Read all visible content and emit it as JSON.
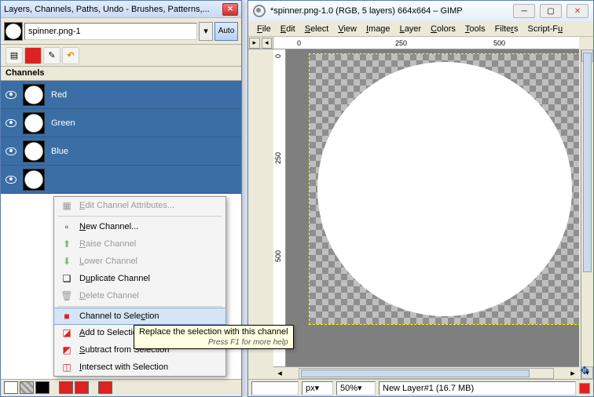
{
  "dock": {
    "title": "Layers, Channels, Paths, Undo - Brushes, Patterns,...",
    "image_selector": {
      "name": "spinner.png-1",
      "auto_label": "Auto"
    },
    "channels_header": "Channels",
    "channels": [
      {
        "name": "Red"
      },
      {
        "name": "Green"
      },
      {
        "name": "Blue"
      },
      {
        "name": ""
      }
    ]
  },
  "context_menu": {
    "items": [
      {
        "label": "Edit Channel Attributes...",
        "enabled": false,
        "icon": "edit"
      },
      {
        "label": "New Channel...",
        "enabled": true,
        "icon": "new"
      },
      {
        "label": "Raise Channel",
        "enabled": false,
        "icon": "up"
      },
      {
        "label": "Lower Channel",
        "enabled": false,
        "icon": "down"
      },
      {
        "label": "Duplicate Channel",
        "enabled": true,
        "icon": "dup"
      },
      {
        "label": "Delete Channel",
        "enabled": false,
        "icon": "del"
      },
      {
        "label": "Channel to Selection",
        "enabled": true,
        "icon": "sel",
        "highlighted": true
      },
      {
        "label": "Add to Selection",
        "enabled": true,
        "icon": "add"
      },
      {
        "label": "Subtract from Selection",
        "enabled": true,
        "icon": "sub"
      },
      {
        "label": "Intersect with Selection",
        "enabled": true,
        "icon": "int"
      }
    ]
  },
  "tooltip": {
    "text": "Replace the selection with this channel",
    "hint": "Press F1 for more help"
  },
  "image_window": {
    "title": "*spinner.png-1.0 (RGB, 5 layers) 664x664 – GIMP",
    "menubar": [
      "File",
      "Edit",
      "Select",
      "View",
      "Image",
      "Layer",
      "Colors",
      "Tools",
      "Filters",
      "Script-Fu"
    ],
    "ruler_h": [
      "0",
      "250",
      "500"
    ],
    "ruler_v": [
      "0",
      "250",
      "500"
    ],
    "status": {
      "units": "px",
      "zoom": "50%",
      "layer": "New Layer#1 (16.7 MB)"
    }
  }
}
